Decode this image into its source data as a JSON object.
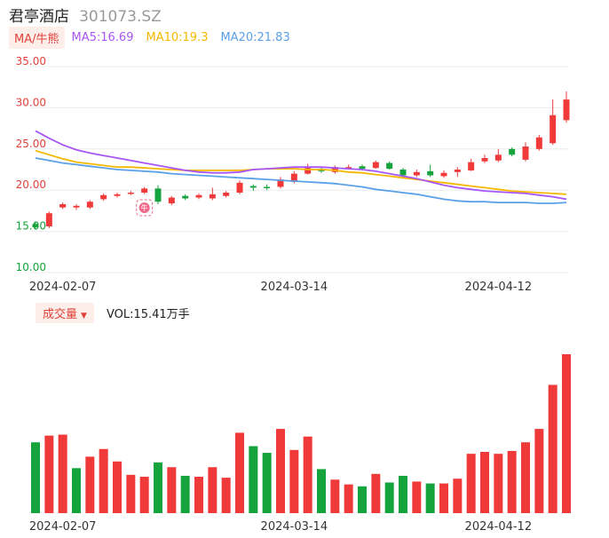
{
  "header": {
    "stock_name": "君亭酒店",
    "stock_code": "301073.SZ"
  },
  "ma_legend": {
    "chip_label": "MA/牛熊",
    "ma5_label": "MA5:16.69",
    "ma10_label": "MA10:19.3",
    "ma20_label": "MA20:21.83",
    "ma5_color": "#a855f7",
    "ma10_color": "#f5b800",
    "ma20_color": "#5aa0e8"
  },
  "volume_legend": {
    "chip_label": "成交量",
    "caret": "▼",
    "vol_label": "VOL:15.41万手"
  },
  "colors": {
    "up": "#f03a3a",
    "down": "#14a33c",
    "grid": "#ececec",
    "text": "#333333",
    "up_axis": "#e0413a",
    "down_axis": "#14a33c",
    "badge": "#f06a8a"
  },
  "bull_badge": {
    "glyph": "牛"
  },
  "chart_data": [
    {
      "type": "candlestick",
      "title": "",
      "ylim": [
        10,
        35
      ],
      "y_ticks": [
        "35.00",
        "30.00",
        "25.00",
        "20.00",
        "15.00",
        "10.00"
      ],
      "x_tick_labels": [
        "2024-02-07",
        "2024-03-14",
        "2024-04-12"
      ],
      "grid": true,
      "candles": [
        {
          "o": 15.9,
          "c": 15.5,
          "h": 16.2,
          "l": 15.2
        },
        {
          "o": 15.6,
          "c": 17.2,
          "h": 17.4,
          "l": 15.4
        },
        {
          "o": 17.9,
          "c": 18.3,
          "h": 18.5,
          "l": 17.7
        },
        {
          "o": 17.9,
          "c": 18.1,
          "h": 18.3,
          "l": 17.6
        },
        {
          "o": 17.9,
          "c": 18.6,
          "h": 18.8,
          "l": 17.7
        },
        {
          "o": 18.9,
          "c": 19.4,
          "h": 19.6,
          "l": 18.7
        },
        {
          "o": 19.3,
          "c": 19.5,
          "h": 19.7,
          "l": 19.1
        },
        {
          "o": 19.6,
          "c": 19.7,
          "h": 19.9,
          "l": 19.4
        },
        {
          "o": 19.7,
          "c": 20.2,
          "h": 20.4,
          "l": 19.5
        },
        {
          "o": 20.2,
          "c": 18.6,
          "h": 20.6,
          "l": 18.3
        },
        {
          "o": 18.4,
          "c": 19.1,
          "h": 19.3,
          "l": 18.2
        },
        {
          "o": 19.3,
          "c": 19.0,
          "h": 19.5,
          "l": 18.8
        },
        {
          "o": 19.1,
          "c": 19.4,
          "h": 19.6,
          "l": 18.9
        },
        {
          "o": 19.0,
          "c": 19.5,
          "h": 20.3,
          "l": 18.8
        },
        {
          "o": 19.3,
          "c": 19.7,
          "h": 19.9,
          "l": 19.1
        },
        {
          "o": 19.7,
          "c": 20.9,
          "h": 21.2,
          "l": 19.5
        },
        {
          "o": 20.5,
          "c": 20.3,
          "h": 20.7,
          "l": 19.9
        },
        {
          "o": 20.4,
          "c": 20.3,
          "h": 20.7,
          "l": 20.0
        },
        {
          "o": 20.4,
          "c": 21.3,
          "h": 21.6,
          "l": 20.2
        },
        {
          "o": 21.0,
          "c": 22.0,
          "h": 22.3,
          "l": 20.8
        },
        {
          "o": 22.0,
          "c": 22.7,
          "h": 23.2,
          "l": 21.9
        },
        {
          "o": 22.6,
          "c": 22.3,
          "h": 22.8,
          "l": 22.1
        },
        {
          "o": 22.2,
          "c": 22.8,
          "h": 23.0,
          "l": 22.0
        },
        {
          "o": 22.7,
          "c": 22.8,
          "h": 23.1,
          "l": 22.5
        },
        {
          "o": 22.9,
          "c": 22.6,
          "h": 23.1,
          "l": 22.4
        },
        {
          "o": 22.7,
          "c": 23.4,
          "h": 23.6,
          "l": 22.6
        },
        {
          "o": 23.3,
          "c": 22.6,
          "h": 23.5,
          "l": 22.5
        },
        {
          "o": 22.5,
          "c": 21.8,
          "h": 22.7,
          "l": 21.5
        },
        {
          "o": 21.8,
          "c": 22.2,
          "h": 22.5,
          "l": 21.6
        },
        {
          "o": 22.3,
          "c": 21.8,
          "h": 23.1,
          "l": 21.6
        },
        {
          "o": 21.7,
          "c": 22.1,
          "h": 22.4,
          "l": 21.5
        },
        {
          "o": 22.2,
          "c": 22.5,
          "h": 22.8,
          "l": 21.6
        },
        {
          "o": 22.4,
          "c": 23.4,
          "h": 23.8,
          "l": 22.3
        },
        {
          "o": 23.5,
          "c": 23.9,
          "h": 24.3,
          "l": 23.3
        },
        {
          "o": 23.6,
          "c": 24.3,
          "h": 25.0,
          "l": 23.4
        },
        {
          "o": 25.0,
          "c": 24.3,
          "h": 25.2,
          "l": 24.1
        },
        {
          "o": 23.7,
          "c": 25.3,
          "h": 25.8,
          "l": 23.5
        },
        {
          "o": 25.0,
          "c": 26.4,
          "h": 26.7,
          "l": 24.8
        },
        {
          "o": 25.7,
          "c": 29.1,
          "h": 31.0,
          "l": 25.5
        },
        {
          "o": 28.5,
          "c": 31.0,
          "h": 32.0,
          "l": 28.2
        }
      ],
      "ma5": [
        27.2,
        26.3,
        25.5,
        24.9,
        24.5,
        24.2,
        23.9,
        23.6,
        23.3,
        23.0,
        22.7,
        22.4,
        22.2,
        22.1,
        22.1,
        22.2,
        22.5,
        22.6,
        22.7,
        22.8,
        22.8,
        22.8,
        22.7,
        22.6,
        22.5,
        22.3,
        22.0,
        21.7,
        21.4,
        21.0,
        20.6,
        20.3,
        20.1,
        19.9,
        19.8,
        19.7,
        19.6,
        19.4,
        19.2,
        18.9
      ],
      "ma10": [
        24.8,
        24.3,
        23.8,
        23.4,
        23.2,
        23.0,
        22.8,
        22.8,
        22.7,
        22.6,
        22.5,
        22.4,
        22.4,
        22.4,
        22.4,
        22.4,
        22.5,
        22.6,
        22.6,
        22.6,
        22.5,
        22.5,
        22.4,
        22.2,
        22.1,
        21.9,
        21.7,
        21.5,
        21.3,
        21.1,
        20.9,
        20.7,
        20.5,
        20.3,
        20.1,
        19.9,
        19.8,
        19.7,
        19.6,
        19.5
      ],
      "ma20": [
        23.9,
        23.6,
        23.3,
        23.1,
        22.9,
        22.7,
        22.5,
        22.4,
        22.3,
        22.2,
        22.0,
        21.9,
        21.8,
        21.7,
        21.6,
        21.5,
        21.4,
        21.3,
        21.2,
        21.1,
        21.0,
        20.9,
        20.8,
        20.6,
        20.4,
        20.1,
        19.9,
        19.7,
        19.5,
        19.2,
        18.9,
        18.7,
        18.6,
        18.6,
        18.5,
        18.5,
        18.5,
        18.4,
        18.4,
        18.5
      ]
    },
    {
      "type": "bar",
      "title": "",
      "x_tick_labels": [
        "2024-02-07",
        "2024-03-14",
        "2024-04-12"
      ],
      "values": [
        7.4,
        8.1,
        8.2,
        4.7,
        5.9,
        6.7,
        5.4,
        4.0,
        3.8,
        5.3,
        4.8,
        3.9,
        3.8,
        4.8,
        3.7,
        8.4,
        7.0,
        6.3,
        8.8,
        6.6,
        8.0,
        4.6,
        3.5,
        3.0,
        2.8,
        4.1,
        3.2,
        3.9,
        3.3,
        3.1,
        3.1,
        3.6,
        6.2,
        6.4,
        6.2,
        6.5,
        7.4,
        8.8,
        13.4,
        16.6
      ],
      "up": [
        false,
        true,
        true,
        false,
        true,
        true,
        true,
        true,
        true,
        false,
        true,
        false,
        true,
        true,
        true,
        true,
        false,
        false,
        true,
        true,
        true,
        false,
        true,
        true,
        false,
        true,
        false,
        false,
        true,
        false,
        true,
        true,
        true,
        true,
        true,
        true,
        true,
        true,
        true,
        true
      ]
    }
  ]
}
